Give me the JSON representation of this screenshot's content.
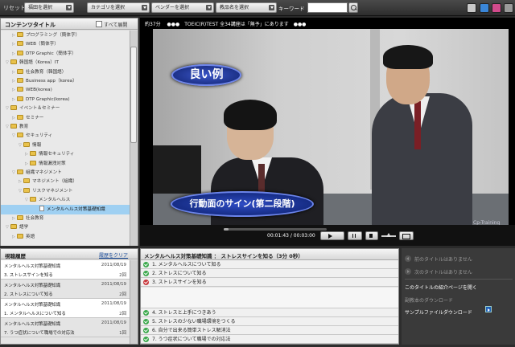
{
  "toolbar": {
    "reset": "リセット",
    "dropdowns": [
      "福田を選択",
      "カテゴリを選択",
      "ベンダーを選択",
      "教品名を選択"
    ],
    "keyword_label": "キーワード",
    "keyword_value": ""
  },
  "tree": {
    "title": "コンテンツタイトル",
    "expand_all": "すべて展開",
    "nodes": [
      {
        "label": "プログラミング（簡体字）",
        "type": "folder",
        "toggle": "▷"
      },
      {
        "label": "WEB（簡体字）",
        "type": "folder",
        "toggle": "▷"
      },
      {
        "label": "DTP Graphic（簡体字）",
        "type": "folder",
        "toggle": "▷"
      },
      {
        "label": "韓国語（Korea）IT",
        "type": "folder",
        "toggle": "▽"
      },
      {
        "label": "社会教育（韓国語）",
        "type": "folder",
        "toggle": "▷"
      },
      {
        "label": "Business app（korea）",
        "type": "folder",
        "toggle": "▷"
      },
      {
        "label": "WEB(korea)",
        "type": "folder",
        "toggle": "▷"
      },
      {
        "label": "DTP Graphic(korea)",
        "type": "folder",
        "toggle": "▷"
      },
      {
        "label": "イベント＆セミナー",
        "type": "folder",
        "toggle": "▽"
      },
      {
        "label": "セミナー",
        "type": "folder",
        "toggle": "▷"
      },
      {
        "label": "教育",
        "type": "folder",
        "toggle": "▽"
      },
      {
        "label": "セキュリティ",
        "type": "folder",
        "toggle": "▽"
      },
      {
        "label": "情報",
        "type": "folder",
        "toggle": "▽"
      },
      {
        "label": "情報セキュリティ",
        "type": "folder",
        "toggle": "▷"
      },
      {
        "label": "情報漏洩対策",
        "type": "folder",
        "toggle": "▷"
      },
      {
        "label": "組織マネジメント",
        "type": "folder",
        "toggle": "▽"
      },
      {
        "label": "マネジメント（組織）",
        "type": "folder",
        "toggle": "▷"
      },
      {
        "label": "リスクマネジメント",
        "type": "folder",
        "toggle": "▽"
      },
      {
        "label": "メンタルヘルス",
        "type": "folder",
        "toggle": "▽"
      },
      {
        "label": "メンタルヘルス対策基礎知識",
        "type": "doc",
        "toggle": ""
      },
      {
        "label": "社会教育",
        "type": "folder",
        "toggle": "▷"
      },
      {
        "label": "語学",
        "type": "folder",
        "toggle": "▽"
      },
      {
        "label": "英語",
        "type": "folder",
        "toggle": "▷"
      }
    ]
  },
  "history": {
    "title": "視聴履歴",
    "clear": "履歴をクリア",
    "rows": [
      {
        "title": "メンタルヘルス対策基礎知識",
        "date": "2011/08/19",
        "chapter": "3. ストレスサインを知る",
        "count": "2回"
      },
      {
        "title": "メンタルヘルス対策基礎知識",
        "date": "2011/08/19",
        "chapter": "2. ストレスについて知る",
        "count": "2回"
      },
      {
        "title": "メンタルヘルス対策基礎知識",
        "date": "2011/08/19",
        "chapter": "1. メンタルヘルスについて知る",
        "count": "2回"
      },
      {
        "title": "メンタルヘルス対策基礎知識",
        "date": "2011/08/19",
        "chapter": "7. うつ症状について職場での対応法",
        "count": "1回"
      }
    ]
  },
  "video": {
    "info": "約37分　 ●●●　TOEIC(R)TEST 全34講座は「無予」にあります　●●●",
    "caption_top": "良い例",
    "caption_bottom": "行動面のサイン(第二段階)",
    "watermark": "Cp-Training",
    "time_current": "00:01:43",
    "time_total": "00:03:00",
    "progress": 0.05
  },
  "chapters": {
    "header": "メンタルヘルス対策基礎知識 ： ストレスサインを知る（3分 0秒）",
    "items": [
      {
        "label": "1. メンタルヘルスについて知る",
        "status": "done"
      },
      {
        "label": "2. ストレスについて知る",
        "status": "done"
      },
      {
        "label": "3. ストレスサインを知る",
        "status": "current"
      },
      {
        "label": "4. ストレスと上手につきあう",
        "status": "done"
      },
      {
        "label": "5. ストレスの少ない職場環境をつくる",
        "status": "done"
      },
      {
        "label": "6. 自分で出来る簡単ストレス解消法",
        "status": "done"
      },
      {
        "label": "7. うつ症状について職場での対応法",
        "status": "done"
      }
    ]
  },
  "right_panel": {
    "prev": "前のタイトルはありません",
    "next": "次のタイトルはありません",
    "intro": "このタイトルの紹介ページを開く",
    "material": "副教本のダウンロード",
    "sample": "サンプルファイルダウンロード"
  },
  "colors": {
    "accent": "#1d5fb8",
    "selected": "#9fd0f2",
    "done": "#39a84a",
    "current": "#c8353a"
  }
}
